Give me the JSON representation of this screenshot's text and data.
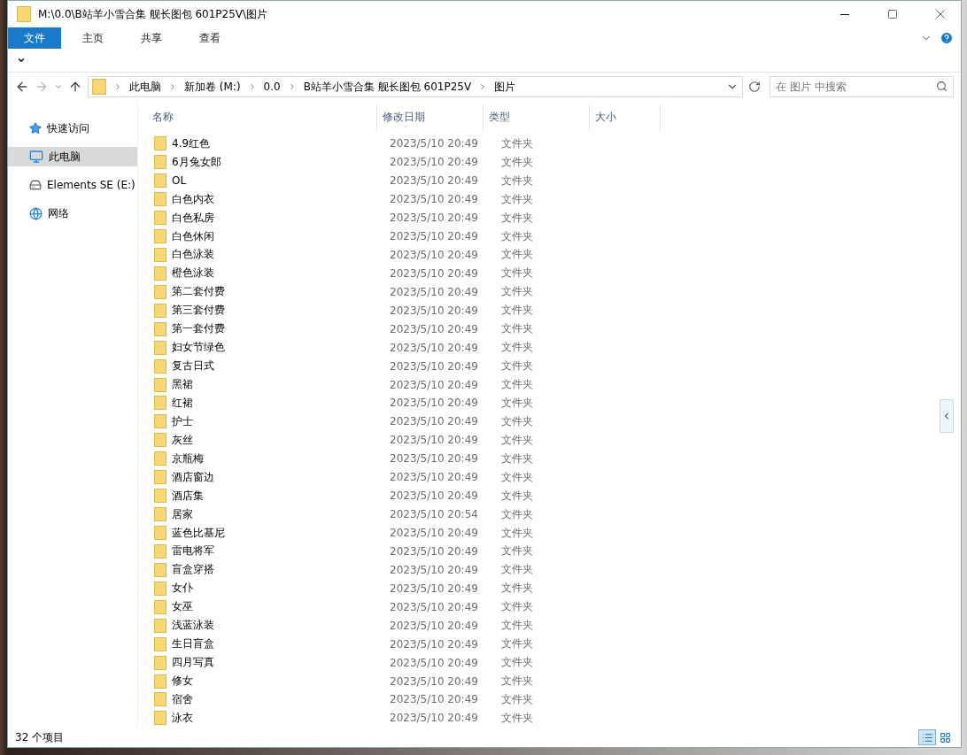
{
  "window": {
    "title": "M:\\0.0\\B站羊小雪合集 舰长图包 601P25V\\图片"
  },
  "ribbon_tabs": [
    {
      "label": "文件",
      "selected": true
    },
    {
      "label": "主页",
      "selected": false
    },
    {
      "label": "共享",
      "selected": false
    },
    {
      "label": "查看",
      "selected": false
    }
  ],
  "breadcrumbs": [
    "此电脑",
    "新加卷 (M:)",
    "0.0",
    "B站羊小雪合集 舰长图包 601P25V",
    "图片"
  ],
  "search": {
    "placeholder": "在 图片 中搜索"
  },
  "sidebar": {
    "items": [
      {
        "label": "快速访问",
        "kind": "star",
        "selected": false
      },
      {
        "label": "此电脑",
        "kind": "pc",
        "selected": true
      },
      {
        "label": "Elements SE (E:)",
        "kind": "drive",
        "selected": false
      },
      {
        "label": "网络",
        "kind": "network",
        "selected": false
      }
    ]
  },
  "table": {
    "columns": [
      "名称",
      "修改日期",
      "类型",
      "大小"
    ],
    "rows": [
      {
        "name": "4.9红色",
        "date": "2023/5/10 20:49",
        "type": "文件夹"
      },
      {
        "name": "6月兔女郎",
        "date": "2023/5/10 20:49",
        "type": "文件夹"
      },
      {
        "name": "OL",
        "date": "2023/5/10 20:49",
        "type": "文件夹"
      },
      {
        "name": "白色内衣",
        "date": "2023/5/10 20:49",
        "type": "文件夹"
      },
      {
        "name": "白色私房",
        "date": "2023/5/10 20:49",
        "type": "文件夹"
      },
      {
        "name": "白色休闲",
        "date": "2023/5/10 20:49",
        "type": "文件夹"
      },
      {
        "name": "白色泳装",
        "date": "2023/5/10 20:49",
        "type": "文件夹"
      },
      {
        "name": "橙色泳装",
        "date": "2023/5/10 20:49",
        "type": "文件夹"
      },
      {
        "name": "第二套付费",
        "date": "2023/5/10 20:49",
        "type": "文件夹"
      },
      {
        "name": "第三套付费",
        "date": "2023/5/10 20:49",
        "type": "文件夹"
      },
      {
        "name": "第一套付费",
        "date": "2023/5/10 20:49",
        "type": "文件夹"
      },
      {
        "name": "妇女节绿色",
        "date": "2023/5/10 20:49",
        "type": "文件夹"
      },
      {
        "name": "复古日式",
        "date": "2023/5/10 20:49",
        "type": "文件夹"
      },
      {
        "name": "黑裙",
        "date": "2023/5/10 20:49",
        "type": "文件夹"
      },
      {
        "name": "红裙",
        "date": "2023/5/10 20:49",
        "type": "文件夹"
      },
      {
        "name": "护士",
        "date": "2023/5/10 20:49",
        "type": "文件夹"
      },
      {
        "name": "灰丝",
        "date": "2023/5/10 20:49",
        "type": "文件夹"
      },
      {
        "name": "京瓶梅",
        "date": "2023/5/10 20:49",
        "type": "文件夹"
      },
      {
        "name": "酒店窗边",
        "date": "2023/5/10 20:49",
        "type": "文件夹"
      },
      {
        "name": "酒店集",
        "date": "2023/5/10 20:49",
        "type": "文件夹"
      },
      {
        "name": "居家",
        "date": "2023/5/10 20:54",
        "type": "文件夹"
      },
      {
        "name": "蓝色比基尼",
        "date": "2023/5/10 20:49",
        "type": "文件夹"
      },
      {
        "name": "雷电将军",
        "date": "2023/5/10 20:49",
        "type": "文件夹"
      },
      {
        "name": "盲盒穿搭",
        "date": "2023/5/10 20:49",
        "type": "文件夹"
      },
      {
        "name": "女仆",
        "date": "2023/5/10 20:49",
        "type": "文件夹"
      },
      {
        "name": "女巫",
        "date": "2023/5/10 20:49",
        "type": "文件夹"
      },
      {
        "name": "浅蓝泳装",
        "date": "2023/5/10 20:49",
        "type": "文件夹"
      },
      {
        "name": "生日盲盒",
        "date": "2023/5/10 20:49",
        "type": "文件夹"
      },
      {
        "name": "四月写真",
        "date": "2023/5/10 20:49",
        "type": "文件夹"
      },
      {
        "name": "修女",
        "date": "2023/5/10 20:49",
        "type": "文件夹"
      },
      {
        "name": "宿舍",
        "date": "2023/5/10 20:49",
        "type": "文件夹"
      },
      {
        "name": "泳衣",
        "date": "2023/5/10 20:49",
        "type": "文件夹"
      }
    ]
  },
  "status_bar": {
    "item_count": "32 个项目"
  }
}
